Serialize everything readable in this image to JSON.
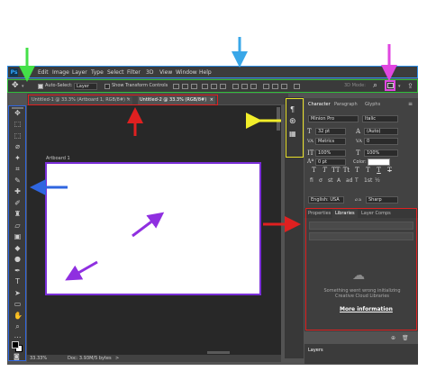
{
  "menubar": {
    "logo": "Ps",
    "items": [
      "File",
      "Edit",
      "Image",
      "Layer",
      "Type",
      "Select",
      "Filter",
      "3D",
      "View",
      "Window",
      "Help"
    ]
  },
  "options_bar": {
    "auto_select_label": "Auto-Select:",
    "auto_select_checked": true,
    "layer_dropdown": "Layer",
    "show_transform_label": "Show Transform Controls",
    "mode_3d_label": "3D Mode:"
  },
  "documents": {
    "tabs": [
      {
        "label": "Untitled-1 @ 33.3% (Artboard 1, RGB/8#) *",
        "active": false
      },
      {
        "label": "Untitled-2 @ 33.3% (RGB/8#)",
        "active": true
      }
    ],
    "close_glyph": "×"
  },
  "artboard": {
    "label": "Artboard 1"
  },
  "status_bar": {
    "zoom": "33.33%",
    "doc": "Doc: 3.93M/5 bytes",
    "arrow": ">"
  },
  "character_panel": {
    "tabs": [
      "Character",
      "Paragraph",
      "Glyphs"
    ],
    "font_family": "Minion Pro",
    "font_style": "Italic",
    "size": "32 pt",
    "leading": "(Auto)",
    "kerning": "Metrics",
    "tracking": "0",
    "vertical_scale": "100%",
    "horizontal_scale": "100%",
    "baseline_shift": "0 pt",
    "color_label": "Color:",
    "language": "English: USA",
    "aa_icon": "a",
    "aa": "Sharp",
    "aa_prefix": "a",
    "text_buttons": [
      "T",
      "T",
      "TT",
      "Tt",
      "T",
      "T",
      "T",
      "T"
    ]
  },
  "libraries_panel": {
    "tabs": [
      "Properties",
      "Libraries",
      "Layer Comps"
    ],
    "error_text": "Something went wrong initializing Creative Cloud Libraries",
    "link": "More information"
  },
  "layers_panel": {
    "title": "Layers"
  },
  "colors": {
    "blue_arrow": "#39a7e8",
    "green_arrow": "#44e048",
    "magenta_arrow": "#e046e0",
    "yellow_arrow": "#f2ee2a",
    "red_arrow": "#e02020",
    "navy_arrow": "#2f66e0",
    "purple_arrow": "#8f2fe0"
  }
}
